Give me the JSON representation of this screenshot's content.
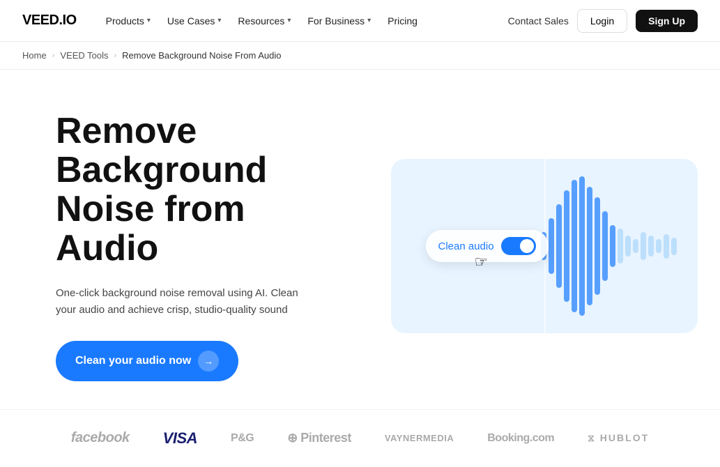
{
  "nav": {
    "logo": "VEED.IO",
    "links": [
      {
        "label": "Products",
        "has_dropdown": true
      },
      {
        "label": "Use Cases",
        "has_dropdown": true
      },
      {
        "label": "Resources",
        "has_dropdown": true
      },
      {
        "label": "For Business",
        "has_dropdown": true
      },
      {
        "label": "Pricing",
        "has_dropdown": false
      }
    ],
    "contact_sales": "Contact Sales",
    "login": "Login",
    "signup": "Sign Up"
  },
  "breadcrumb": {
    "home": "Home",
    "tools": "VEED Tools",
    "current": "Remove Background Noise From Audio"
  },
  "hero": {
    "title": "Remove Background Noise from Audio",
    "description": "One-click background noise removal using AI. Clean your audio and achieve crisp, studio-quality sound",
    "cta_label": "Clean your audio now",
    "illustration": {
      "toggle_label": "Clean audio"
    }
  },
  "logos": [
    {
      "name": "facebook",
      "display": "facebook",
      "class": "facebook"
    },
    {
      "name": "visa",
      "display": "VISA",
      "class": "visa"
    },
    {
      "name": "pg",
      "display": "P&G",
      "class": "pg"
    },
    {
      "name": "pinterest",
      "display": "⊕ Pinterest",
      "class": "pinterest"
    },
    {
      "name": "vaynermedia",
      "display": "VAYNERMEDIA",
      "class": "vaynermedia"
    },
    {
      "name": "booking",
      "display": "Booking.com",
      "class": "booking"
    },
    {
      "name": "hublot",
      "display": "⧖ HUBLOT",
      "class": "hublot"
    }
  ]
}
